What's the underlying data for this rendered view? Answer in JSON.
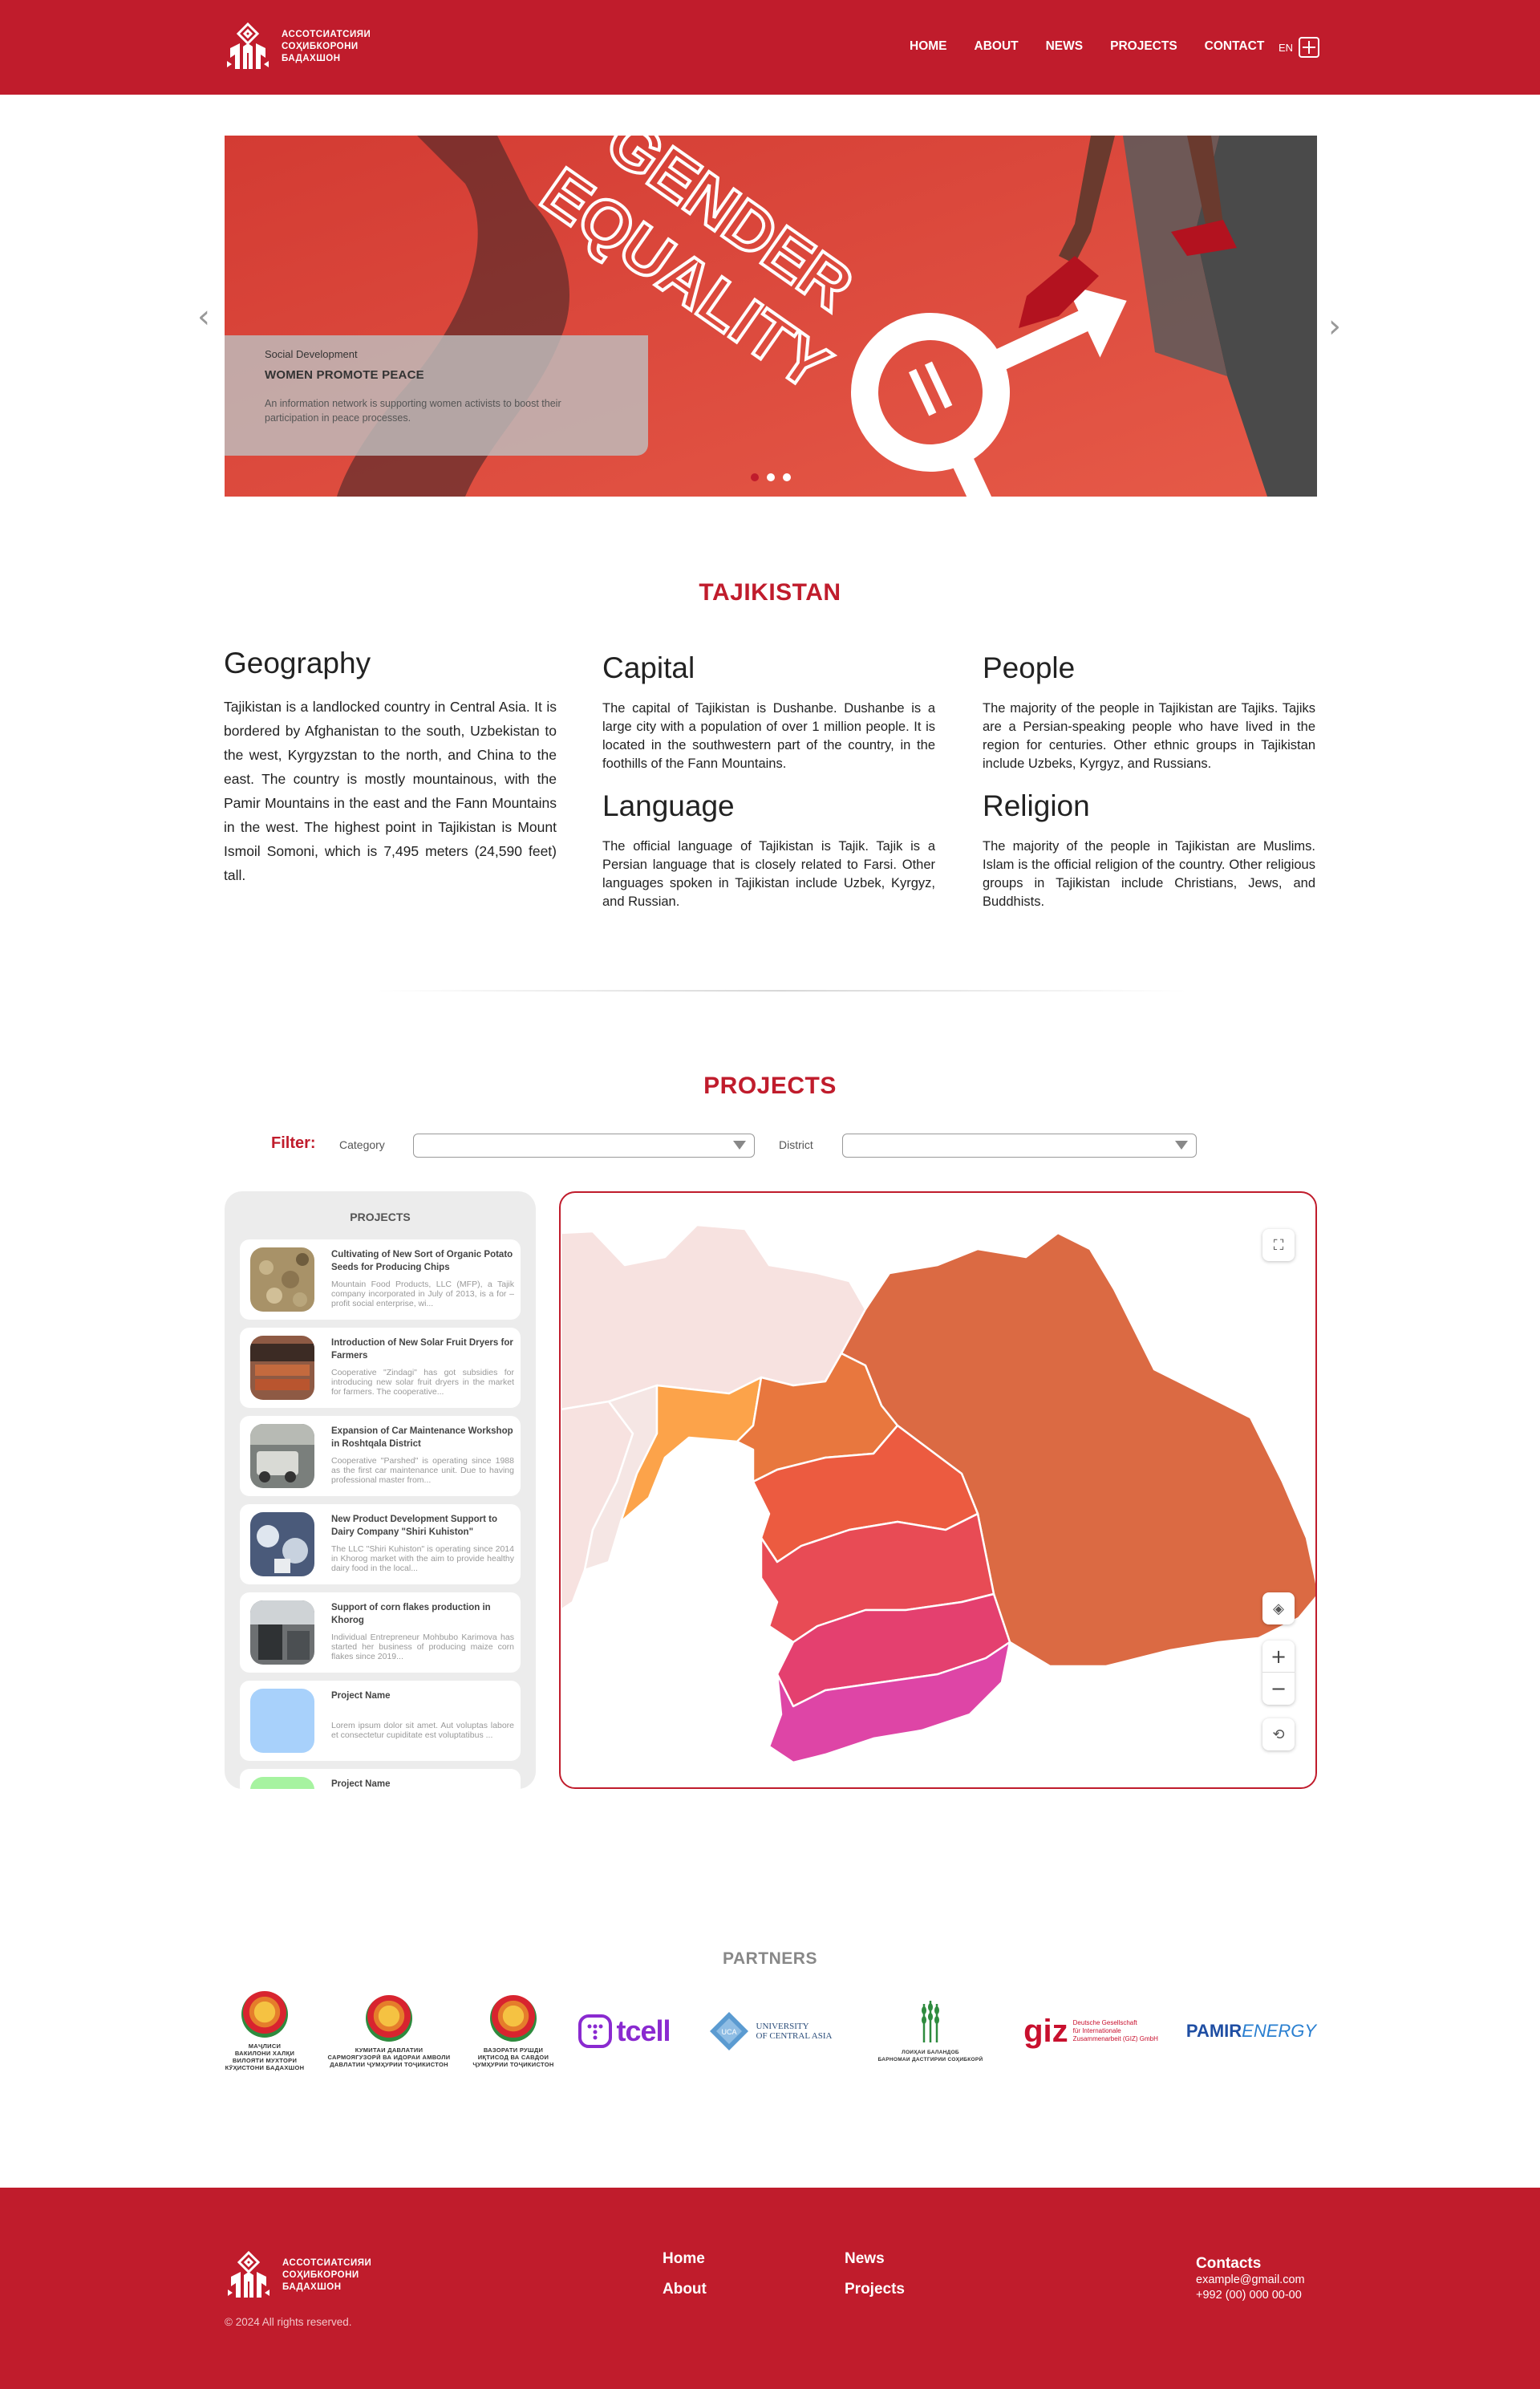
{
  "header": {
    "logo_lines": [
      "АССОТСИАТСИЯИ",
      "СОҲИБКОРОНИ",
      "БАДАХШОН"
    ],
    "nav": [
      "HOME",
      "ABOUT",
      "NEWS",
      "PROJECTS",
      "CONTACT"
    ],
    "lang": "EN"
  },
  "slider": {
    "category": "Social Development",
    "title": "WOMEN PROMOTE PEACE",
    "description": "An information network is supporting women activists to boost their participation in peace processes.",
    "image_text": [
      "GENDER",
      "EQUALITY"
    ],
    "slides": 3,
    "active_slide": 1
  },
  "country": {
    "title": "TAJIKISTAN",
    "blocks": {
      "geography": {
        "heading": "Geography",
        "text": "Tajikistan is a landlocked country in Central Asia. It is bordered by Afghanistan to the south, Uzbekistan to the west, Kyrgyzstan to the north, and China to the east. The country is mostly mountainous, with the Pamir Mountains in the east and the Fann Mountains in the west. The highest point in Tajikistan is Mount Ismoil Somoni, which is 7,495 meters (24,590 feet) tall."
      },
      "capital": {
        "heading": "Capital",
        "text": "The capital of Tajikistan is Dushanbe. Dushanbe is a large city with a population of over 1 million people. It is located in the southwestern part of the country, in the foothills of the Fann Mountains."
      },
      "people": {
        "heading": "People",
        "text": "The majority of the people in Tajikistan are Tajiks. Tajiks are a Persian-speaking people who have lived in the region for centuries. Other ethnic groups in Tajikistan include Uzbeks, Kyrgyz, and Russians."
      },
      "language": {
        "heading": "Language",
        "text": "The official language of Tajikistan is Tajik. Tajik is a Persian language that is closely related to Farsi. Other languages spoken in Tajikistan include Uzbek, Kyrgyz, and Russian."
      },
      "religion": {
        "heading": "Religion",
        "text": "The majority of the people in Tajikistan are Muslims. Islam is the official religion of the country. Other religious groups in Tajikistan include Christians, Jews, and Buddhists."
      }
    }
  },
  "projects": {
    "title": "PROJECTS",
    "filter_label": "Filter:",
    "category_label": "Category",
    "district_label": "District",
    "category_value": "",
    "district_value": "",
    "list_title": "PROJECTS",
    "items": [
      {
        "title": "Cultivating of New Sort of Organic Potato Seeds for Producing Chips",
        "desc": "Mountain Food Products, LLC (MFP), a Tajik company incorporated in July of 2013, is a for – profit social enterprise, wi...",
        "thumb_color": "#a89268"
      },
      {
        "title": "Introduction of New Solar Fruit Dryers for Farmers",
        "desc": "Cooperative \"Zindagi\" has got subsidies for introducing new solar fruit dryers in the market for farmers. The cooperative...",
        "thumb_color": "#8e5a44"
      },
      {
        "title": "Expansion of Car Maintenance Workshop in Roshtqala District",
        "desc": "Cooperative \"Parshed\" is operating since 1988 as the first car maintenance unit. Due to having professional master from...",
        "thumb_color": "#7a7f7c"
      },
      {
        "title": "New Product Development Support to Dairy Company \"Shiri Kuhiston\"",
        "desc": "The LLC \"Shiri Kuhiston\" is operating since 2014 in Khorog market with the aim to provide healthy dairy food in the local...",
        "thumb_color": "#4a5a7a"
      },
      {
        "title": "Support of corn flakes production in Khorog",
        "desc": "Individual Entrepreneur Mohbubo Karimova has started her business of producing maize corn flakes since 2019...",
        "thumb_color": "#6d7072"
      },
      {
        "title": "Project Name",
        "desc": "Lorem ipsum dolor sit amet. Aut voluptas labore et consectetur cupiditate est voluptatibus ...",
        "thumb_color": "#a8d1fb"
      },
      {
        "title": "Project Name",
        "desc": "",
        "thumb_color": "#a6f3a0"
      }
    ]
  },
  "partners": {
    "title": "PARTNERS",
    "items": [
      {
        "label_lines": [
          "МАҶЛИСИ",
          "ВАКИЛОНИ ХАЛҚИ",
          "ВИЛОЯТИ МУХТОРИ",
          "КӮҲИСТОНИ БАДАХШОН"
        ]
      },
      {
        "label_lines": [
          "КУМИТАИ ДАВЛАТИИ",
          "САРМОЯГУЗОРӢ ВА ИДОРАИ АМВОЛИ",
          "ДАВЛАТИИ ҶУМҲУРИИ ТОҶИКИСТОН"
        ]
      },
      {
        "label_lines": [
          "ВАЗОРАТИ РУШДИ",
          "ИҚТИСОД ВА САВДОИ",
          "ҶУМҲУРИИ ТОҶИКИСТОН"
        ]
      },
      {
        "label_lines": [
          "tcell"
        ]
      },
      {
        "label_lines": [
          "UCA",
          "UNIVERSITY",
          "OF CENTRAL ASIA"
        ]
      },
      {
        "label_lines": [
          "ЛОИҲАИ БАЛАНДОБ",
          "БАРНОМАИ ДАСТГИРИИ СОҲИБКОРӢ"
        ]
      },
      {
        "label_lines": [
          "giz",
          "Deutsche Gesellschaft",
          "für Internationale",
          "Zusammenarbeit (GIZ) GmbH"
        ]
      },
      {
        "label_lines": [
          "PAMIR",
          "ENERGY"
        ]
      }
    ]
  },
  "footer": {
    "logo_lines": [
      "АССОТСИАТСИЯИ",
      "СОҲИБКОРОНИ",
      "БАДАХШОН"
    ],
    "links": [
      "Home",
      "About",
      "News",
      "Projects"
    ],
    "contacts_heading": "Contacts",
    "email": "example@gmail.com",
    "phone": "+992 (00) 000 00-00",
    "copyright": "© 2024 All rights reserved."
  },
  "colors": {
    "brand_red": "#c01c2c",
    "map_orange": "#db6a43",
    "map_pink": "#e0419e"
  }
}
